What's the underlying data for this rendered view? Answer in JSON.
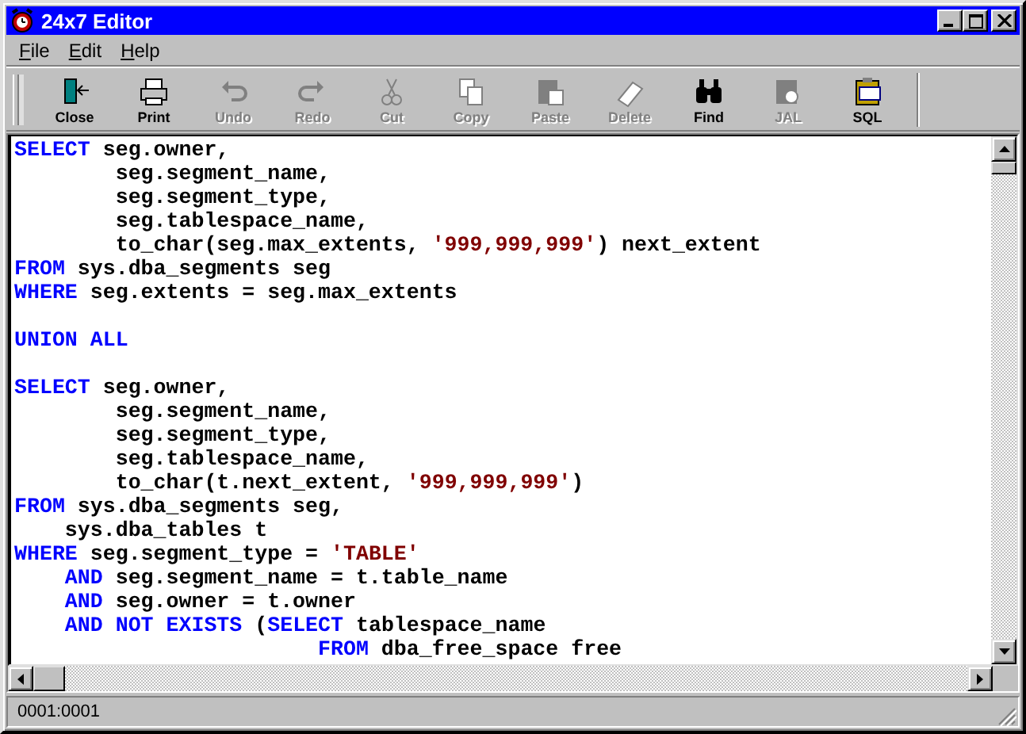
{
  "window": {
    "title": "24x7 Editor"
  },
  "menu": [
    {
      "label": "File"
    },
    {
      "label": "Edit"
    },
    {
      "label": "Help"
    }
  ],
  "toolbar": [
    {
      "label": "Close",
      "disabled": false
    },
    {
      "label": "Print",
      "disabled": false
    },
    {
      "label": "Undo",
      "disabled": true
    },
    {
      "label": "Redo",
      "disabled": true
    },
    {
      "label": "Cut",
      "disabled": true
    },
    {
      "label": "Copy",
      "disabled": true
    },
    {
      "label": "Paste",
      "disabled": true
    },
    {
      "label": "Delete",
      "disabled": true
    },
    {
      "label": "Find",
      "disabled": false
    },
    {
      "label": "JAL",
      "disabled": true
    },
    {
      "label": "SQL",
      "disabled": false
    }
  ],
  "editor": {
    "lines": [
      {
        "kind": "code",
        "segments": [
          {
            "kind": "kw",
            "text": "SELECT"
          },
          {
            "kind": "plain",
            "text": " seg.owner,"
          }
        ]
      },
      {
        "kind": "code",
        "segments": [
          {
            "kind": "plain",
            "text": "        seg.segment_name,"
          }
        ]
      },
      {
        "kind": "code",
        "segments": [
          {
            "kind": "plain",
            "text": "        seg.segment_type,"
          }
        ]
      },
      {
        "kind": "code",
        "segments": [
          {
            "kind": "plain",
            "text": "        seg.tablespace_name,"
          }
        ]
      },
      {
        "kind": "code",
        "segments": [
          {
            "kind": "plain",
            "text": "        to_char(seg.max_extents, "
          },
          {
            "kind": "str",
            "text": "'999,999,999'"
          },
          {
            "kind": "plain",
            "text": ") next_extent"
          }
        ]
      },
      {
        "kind": "code",
        "segments": [
          {
            "kind": "kw",
            "text": "FROM"
          },
          {
            "kind": "plain",
            "text": " sys.dba_segments seg"
          }
        ]
      },
      {
        "kind": "code",
        "segments": [
          {
            "kind": "kw",
            "text": "WHERE"
          },
          {
            "kind": "plain",
            "text": " seg.extents = seg.max_extents"
          }
        ]
      },
      {
        "kind": "blank"
      },
      {
        "kind": "code",
        "segments": [
          {
            "kind": "kw",
            "text": "UNION ALL"
          }
        ]
      },
      {
        "kind": "blank"
      },
      {
        "kind": "code",
        "segments": [
          {
            "kind": "kw",
            "text": "SELECT"
          },
          {
            "kind": "plain",
            "text": " seg.owner,"
          }
        ]
      },
      {
        "kind": "code",
        "segments": [
          {
            "kind": "plain",
            "text": "        seg.segment_name,"
          }
        ]
      },
      {
        "kind": "code",
        "segments": [
          {
            "kind": "plain",
            "text": "        seg.segment_type,"
          }
        ]
      },
      {
        "kind": "code",
        "segments": [
          {
            "kind": "plain",
            "text": "        seg.tablespace_name,"
          }
        ]
      },
      {
        "kind": "code",
        "segments": [
          {
            "kind": "plain",
            "text": "        to_char(t.next_extent, "
          },
          {
            "kind": "str",
            "text": "'999,999,999'"
          },
          {
            "kind": "plain",
            "text": ")"
          }
        ]
      },
      {
        "kind": "code",
        "segments": [
          {
            "kind": "kw",
            "text": "FROM"
          },
          {
            "kind": "plain",
            "text": " sys.dba_segments seg,"
          }
        ]
      },
      {
        "kind": "code",
        "segments": [
          {
            "kind": "plain",
            "text": "    sys.dba_tables t"
          }
        ]
      },
      {
        "kind": "code",
        "segments": [
          {
            "kind": "kw",
            "text": "WHERE"
          },
          {
            "kind": "plain",
            "text": " seg.segment_type = "
          },
          {
            "kind": "str",
            "text": "'TABLE'"
          }
        ]
      },
      {
        "kind": "code",
        "segments": [
          {
            "kind": "kw",
            "text": "    AND"
          },
          {
            "kind": "plain",
            "text": " seg.segment_name = t.table_name"
          }
        ]
      },
      {
        "kind": "code",
        "segments": [
          {
            "kind": "kw",
            "text": "    AND"
          },
          {
            "kind": "plain",
            "text": " seg.owner = t.owner"
          }
        ]
      },
      {
        "kind": "code",
        "segments": [
          {
            "kind": "kw",
            "text": "    AND NOT EXISTS"
          },
          {
            "kind": "plain",
            "text": " ("
          },
          {
            "kind": "kw",
            "text": "SELECT"
          },
          {
            "kind": "plain",
            "text": " tablespace_name"
          }
        ]
      },
      {
        "kind": "code",
        "segments": [
          {
            "kind": "kw",
            "text": "                        FROM"
          },
          {
            "kind": "plain",
            "text": " dba_free_space free"
          }
        ]
      }
    ]
  },
  "status_bar": {
    "position": "0001:0001"
  }
}
